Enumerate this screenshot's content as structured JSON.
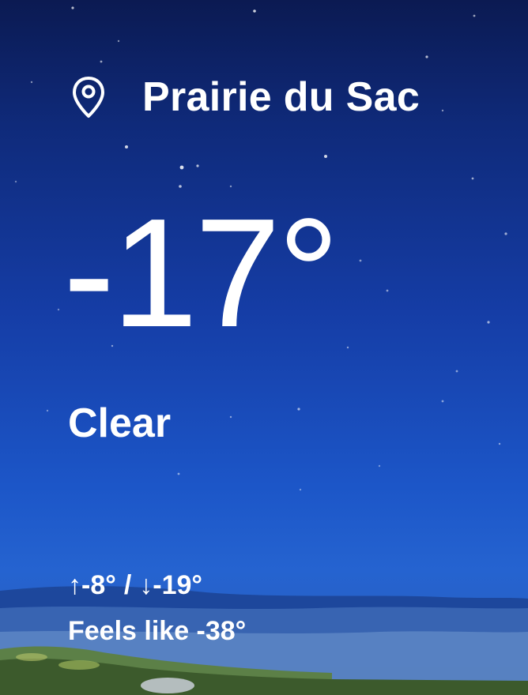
{
  "location": {
    "name": "Prairie du Sac",
    "icon": "location-pin-icon"
  },
  "current": {
    "temperature": "-17°",
    "condition": "Clear"
  },
  "forecast": {
    "high_arrow": "↑",
    "high": "-8°",
    "separator": "/",
    "low_arrow": "↓",
    "low": "-19°",
    "feels_like": "Feels like -38°"
  },
  "colors": {
    "sky_top": "#0b1a52",
    "sky_bottom": "#2563d0",
    "text": "#ffffff"
  }
}
